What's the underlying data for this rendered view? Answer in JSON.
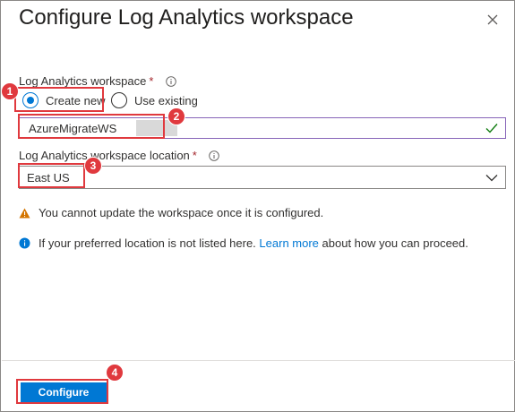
{
  "dialog": {
    "title": "Configure Log Analytics workspace",
    "close_icon": "close-icon"
  },
  "workspace": {
    "label": "Log Analytics workspace",
    "required_mark": "*",
    "info_icon": "info-icon",
    "options": [
      {
        "label": "Create new",
        "selected": true
      },
      {
        "label": "Use existing",
        "selected": false
      }
    ],
    "name_value": "AzureMigrateWS",
    "valid_icon": "checkmark-icon"
  },
  "location": {
    "label": "Log Analytics workspace location",
    "required_mark": "*",
    "info_icon": "info-icon",
    "selected": "East US",
    "dropdown_icon": "chevron-down-icon"
  },
  "messages": {
    "warning_icon": "warning-icon",
    "warning_text": "You cannot update the workspace once it is configured.",
    "info_icon": "info-circle-icon",
    "info_prefix": "If your preferred location is not listed here.",
    "info_link": "Learn more",
    "info_suffix": "about how you can proceed."
  },
  "footer": {
    "configure_label": "Configure"
  },
  "annotations": {
    "step_1": "1",
    "step_2": "2",
    "step_3": "3",
    "step_4": "4",
    "color": "#e0393e"
  },
  "colors": {
    "accent": "#0078d4",
    "warning": "#d47500",
    "valid": "#107c10",
    "required": "#a4262c"
  }
}
